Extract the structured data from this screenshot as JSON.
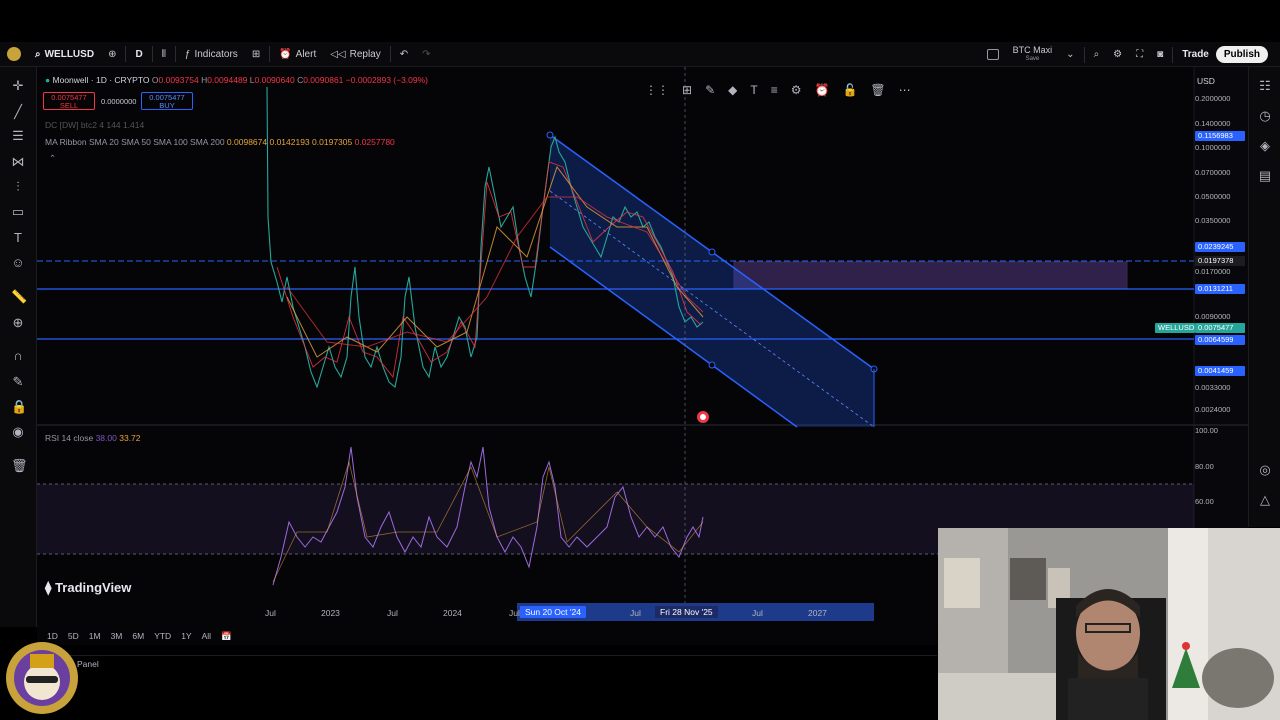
{
  "topbar": {
    "symbol": "WELLUSD",
    "interval": "D",
    "indicators": "Indicators",
    "alert": "Alert",
    "replay": "Replay",
    "layout_name": "BTC Maxi",
    "layout_status": "Save",
    "trade": "Trade",
    "publish": "Publish"
  },
  "legend": {
    "title": "Moonwell · 1D · CRYPTO",
    "o": "O",
    "o_val": "0.0093754",
    "h": "H",
    "h_val": "0.0094489",
    "l": "L",
    "l_val": "0.0090640",
    "c": "C",
    "c_val": "0.0090861",
    "change": "−0.0002893 (−3.09%)",
    "sell_price": "0.0075477",
    "sell_label": "SELL",
    "spread": "0.0000000",
    "buy_price": "0.0075477",
    "buy_label": "BUY",
    "dc_line": "DC [DW] btc2 4 144 1.414",
    "ma_label": "MA Ribbon SMA 20 SMA 50 SMA 100 SMA 200",
    "ma_v1": "0.0098674",
    "ma_v2": "0.0142193",
    "ma_v3": "0.0197305",
    "ma_v4": "0.0257780"
  },
  "currency": "USD",
  "price_axis": {
    "labels": [
      "0.2000000",
      "0.1400000",
      "0.1000000",
      "0.0700000",
      "0.0500000",
      "0.0350000",
      "0.0170000",
      "0.0090000",
      "0.0033000",
      "0.0024000"
    ],
    "tag_top": "0.1156983",
    "tag_a": "0.0239245",
    "tag_b": "0.0197378",
    "tag_c": "0.0131211",
    "tag_symbol": "WELLUSD",
    "tag_current": "0.0075477",
    "tag_d": "0.0064599",
    "tag_e": "0.0041459"
  },
  "rsi": {
    "label": "RSI 14 close",
    "v1": "38.00",
    "v2": "33.72",
    "axis": [
      "100.00",
      "80.00",
      "60.00"
    ]
  },
  "time_axis": {
    "labels": [
      "Jul",
      "2023",
      "Jul",
      "2024",
      "Jul",
      "Jul",
      "Jul",
      "2027"
    ],
    "tag_left": "Sun 20 Oct '24",
    "tag_right": "Fri 28 Nov '25"
  },
  "watermark": "TradingView",
  "ranges": [
    "1D",
    "5D",
    "1M",
    "3M",
    "6M",
    "YTD",
    "1Y",
    "All"
  ],
  "panel": "Panel",
  "colors": {
    "accent": "#2962ff",
    "up": "#26a69a",
    "down": "#f23645",
    "channel": "#2962ff",
    "zone": "#7e57c2"
  }
}
